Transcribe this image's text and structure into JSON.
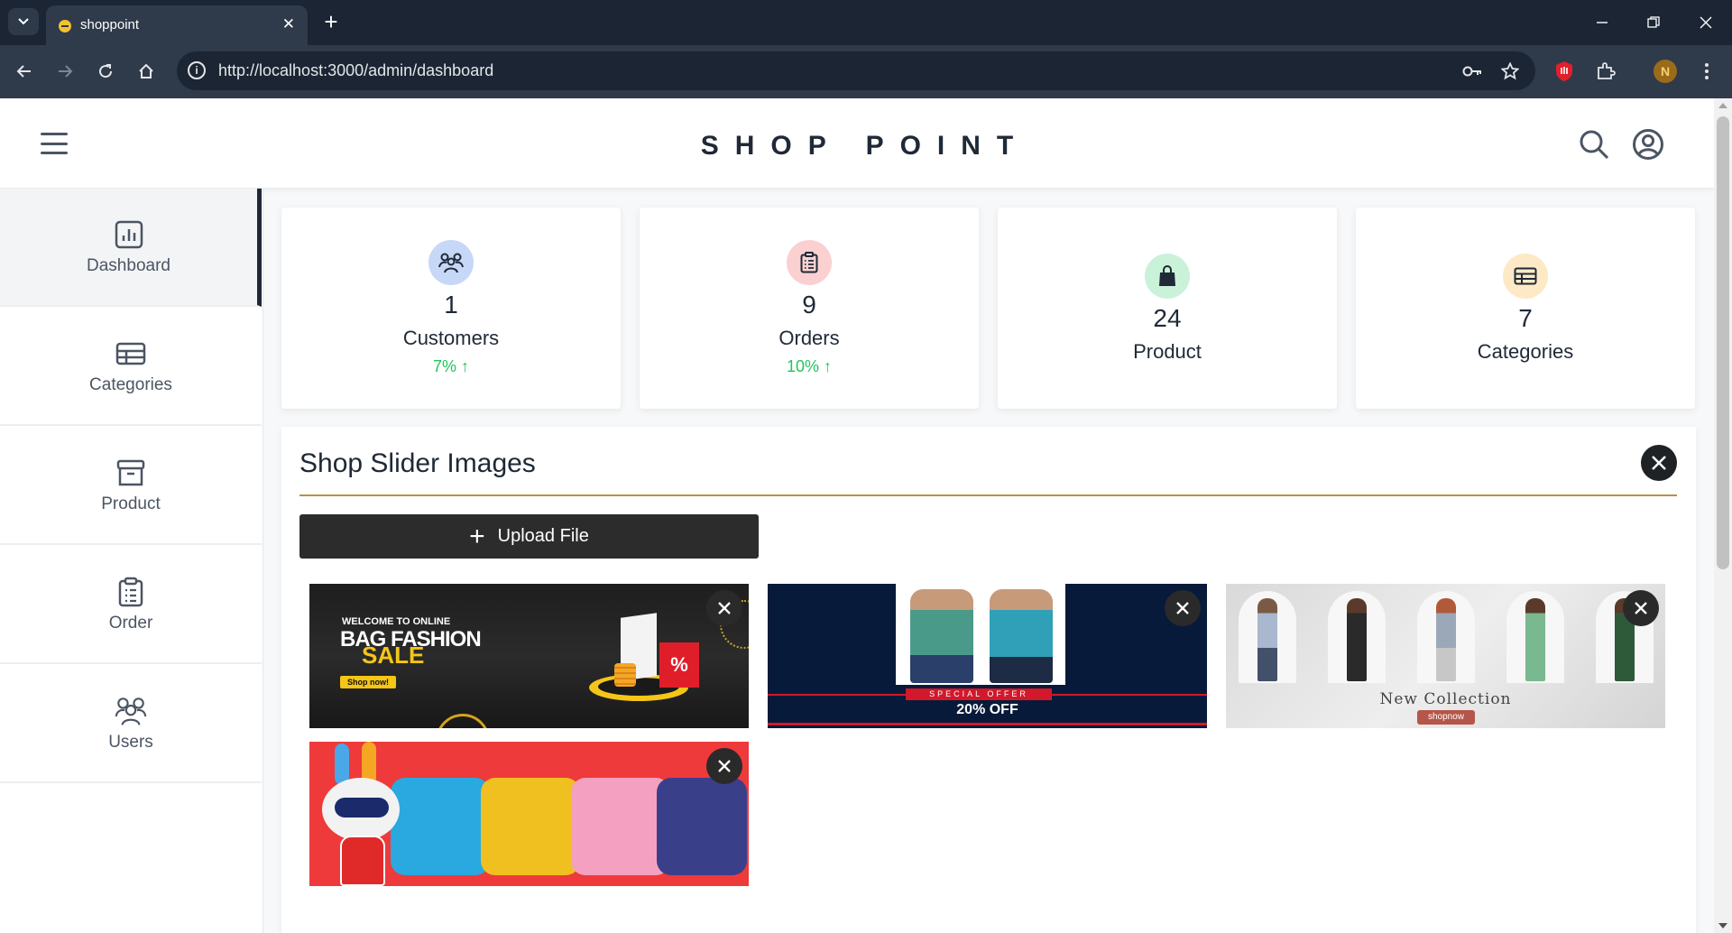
{
  "browser": {
    "tab_title": "shoppoint",
    "url": "http://localhost:3000/admin/dashboard",
    "profile_initial": "N"
  },
  "header": {
    "brand": "SHOP POINT"
  },
  "sidebar": {
    "items": [
      {
        "label": "Dashboard",
        "icon": "bar-chart-icon",
        "active": true
      },
      {
        "label": "Categories",
        "icon": "table-icon",
        "active": false
      },
      {
        "label": "Product",
        "icon": "archive-icon",
        "active": false
      },
      {
        "label": "Order",
        "icon": "clipboard-icon",
        "active": false
      },
      {
        "label": "Users",
        "icon": "users-icon",
        "active": false
      }
    ]
  },
  "stats": [
    {
      "value": "1",
      "label": "Customers",
      "change": "7% ↑",
      "icon": "users-icon",
      "color": "#c7d7f8"
    },
    {
      "value": "9",
      "label": "Orders",
      "change": "10% ↑",
      "icon": "clipboard-icon",
      "color": "#fbd0d0"
    },
    {
      "value": "24",
      "label": "Product",
      "change": "",
      "icon": "shopping-bag-icon",
      "color": "#c9f2d8"
    },
    {
      "value": "7",
      "label": "Categories",
      "change": "",
      "icon": "table-icon",
      "color": "#fde9c6"
    }
  ],
  "slider": {
    "title": "Shop Slider Images",
    "upload_label": "Upload File",
    "images": [
      {
        "welcome": "WELCOME TO ONLINE",
        "headline": "BAG FASHION",
        "highlight": "SALE",
        "cta": "Shop now!",
        "badge": "%"
      },
      {
        "offer": "SPECIAL OFFER",
        "discount": "20% OFF"
      },
      {
        "caption": "New Collection",
        "cta": "shopnow"
      },
      {}
    ]
  },
  "colors": {
    "accent_rule": "#b8924a",
    "positive": "#22c55e",
    "dark_button": "#2c2c2c"
  }
}
